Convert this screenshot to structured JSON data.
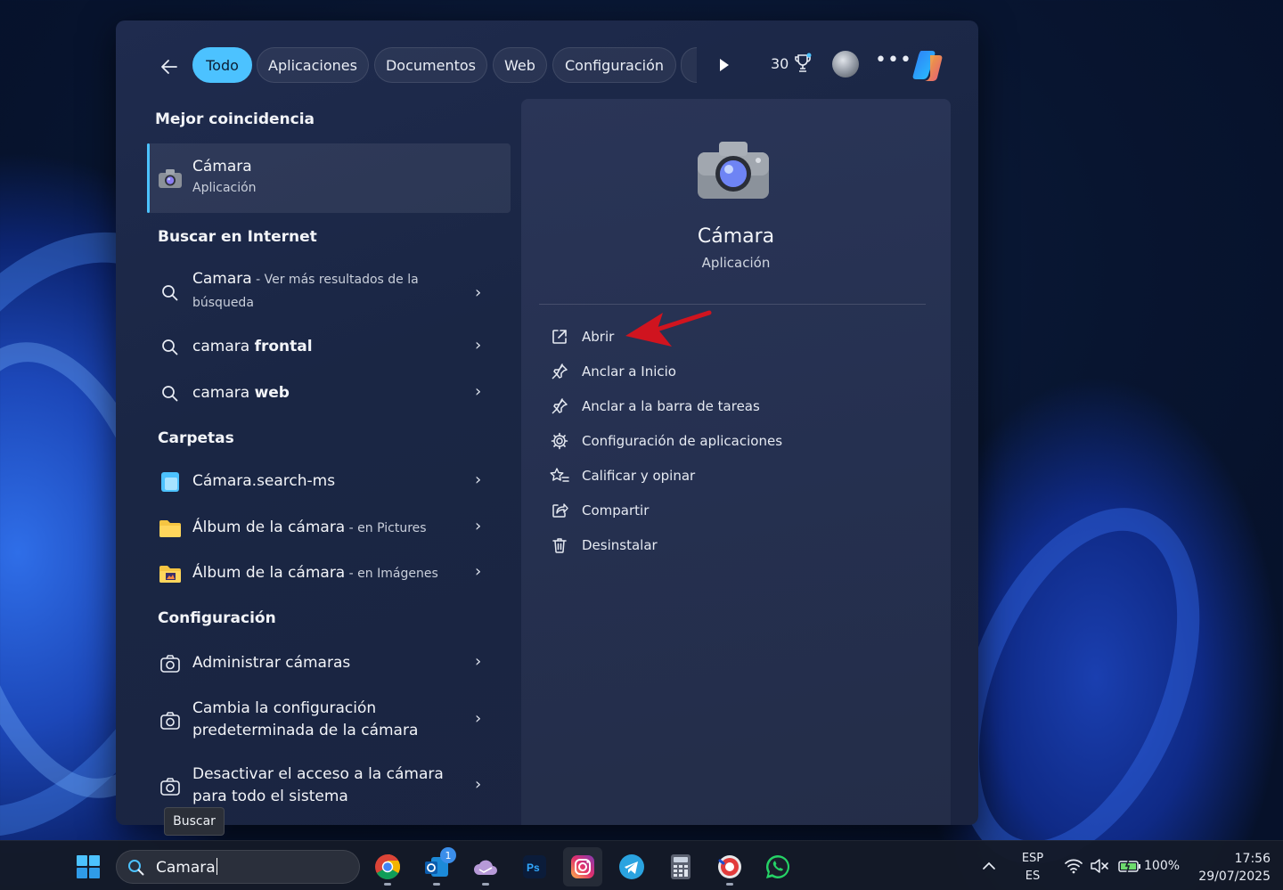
{
  "topbar": {
    "tabs": [
      {
        "label": "Todo",
        "active": true
      },
      {
        "label": "Aplicaciones",
        "active": false
      },
      {
        "label": "Documentos",
        "active": false
      },
      {
        "label": "Web",
        "active": false
      },
      {
        "label": "Configuración",
        "active": false
      }
    ],
    "points": "30"
  },
  "best_match": {
    "section_title": "Mejor coincidencia",
    "title": "Cámara",
    "subtitle": "Aplicación"
  },
  "internet": {
    "section_title": "Buscar en Internet",
    "items": [
      {
        "query": "Camara",
        "suffix": " - Ver más resultados de la",
        "suffix2": "búsqueda"
      },
      {
        "query": "camara ",
        "bold": "frontal"
      },
      {
        "query": "camara ",
        "bold": "web"
      }
    ]
  },
  "folders": {
    "section_title": "Carpetas",
    "items": [
      {
        "name": "Cámara.search-ms",
        "location": ""
      },
      {
        "name": "Álbum de la cámara",
        "location": " - en Pictures"
      },
      {
        "name": "Álbum de la cámara",
        "location": " - en Imágenes"
      }
    ]
  },
  "settings": {
    "section_title": "Configuración",
    "items": [
      {
        "line1": "Administrar cámaras",
        "line2": ""
      },
      {
        "line1": "Cambia la configuración",
        "line2": "predeterminada de la cámara"
      },
      {
        "line1": "Desactivar el acceso a la cámara",
        "line2": "para todo el sistema"
      }
    ]
  },
  "detail": {
    "title": "Cámara",
    "subtitle": "Aplicación",
    "actions": [
      {
        "label": "Abrir",
        "icon": "open-external-icon"
      },
      {
        "label": "Anclar a Inicio",
        "icon": "pin-icon"
      },
      {
        "label": "Anclar a la barra de tareas",
        "icon": "pin-icon"
      },
      {
        "label": "Configuración de aplicaciones",
        "icon": "gear-icon"
      },
      {
        "label": "Calificar y opinar",
        "icon": "star-list-icon"
      },
      {
        "label": "Compartir",
        "icon": "share-icon"
      },
      {
        "label": "Desinstalar",
        "icon": "trash-icon"
      }
    ]
  },
  "tooltip": "Buscar",
  "taskbar": {
    "search_value": "Camara",
    "outlook_badge": "1",
    "lang_top": "ESP",
    "lang_bottom": "ES",
    "battery": "100%",
    "time": "17:56",
    "date": "29/07/2025"
  },
  "colors": {
    "accent": "#4cc2ff",
    "panel": "#1f2b4e",
    "annotation_arrow": "#d0141f"
  }
}
